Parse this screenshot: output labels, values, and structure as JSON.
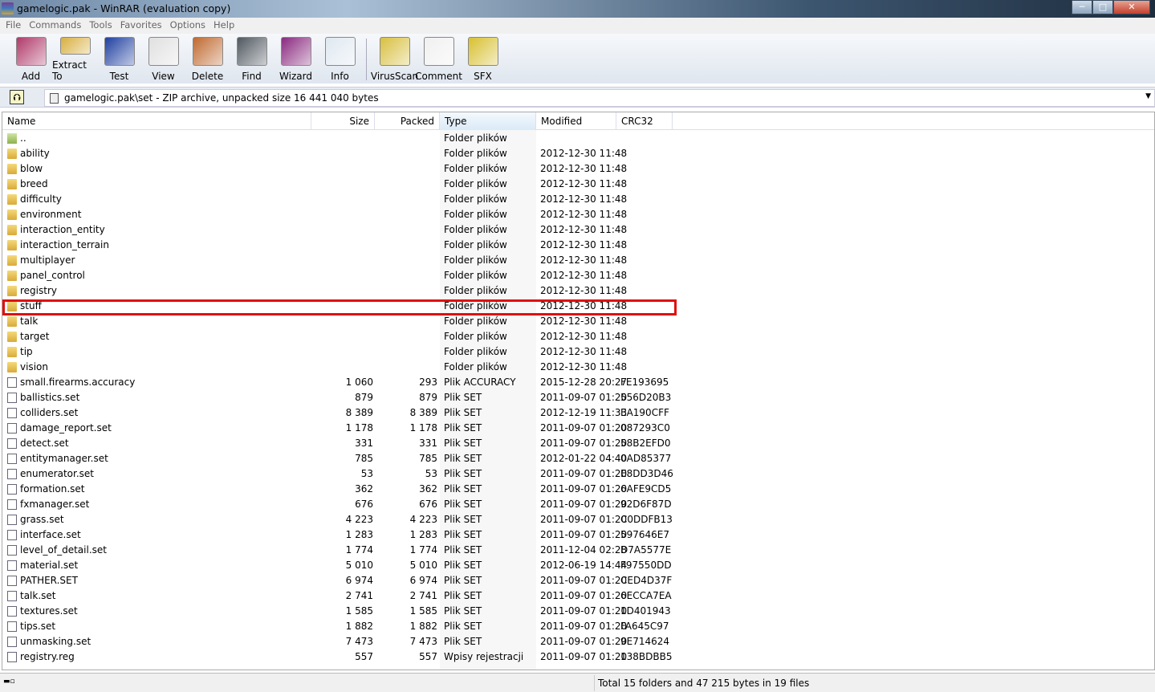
{
  "window": {
    "title": "gamelogic.pak - WinRAR (evaluation copy)",
    "minimize": "─",
    "maximize": "□",
    "close": "✕"
  },
  "menu": [
    "File",
    "Commands",
    "Tools",
    "Favorites",
    "Options",
    "Help"
  ],
  "toolbar": [
    {
      "label": "Add",
      "icon": "add-icon",
      "color": "#b03a6a"
    },
    {
      "label": "Extract To",
      "icon": "extract-icon",
      "color": "#d8b040"
    },
    {
      "label": "Test",
      "icon": "test-icon",
      "color": "#2040a0"
    },
    {
      "label": "View",
      "icon": "view-icon",
      "color": "#e0e0e0"
    },
    {
      "label": "Delete",
      "icon": "delete-icon",
      "color": "#c06a30"
    },
    {
      "label": "Find",
      "icon": "find-icon",
      "color": "#505860"
    },
    {
      "label": "Wizard",
      "icon": "wizard-icon",
      "color": "#8a2a80"
    },
    {
      "label": "Info",
      "icon": "info-icon",
      "color": "#dfe8f0"
    },
    {
      "label": "VirusScan",
      "icon": "virusscan-icon",
      "color": "#d8c040"
    },
    {
      "label": "Comment",
      "icon": "comment-icon",
      "color": "#f0f0f0"
    },
    {
      "label": "SFX",
      "icon": "sfx-icon",
      "color": "#d8c030"
    }
  ],
  "address": {
    "text": "gamelogic.pak\\set - ZIP archive, unpacked size 16 441 040 bytes",
    "dropdown": "▼",
    "up": "⮉"
  },
  "columns": {
    "name": "Name",
    "size": "Size",
    "packed": "Packed",
    "type": "Type",
    "modified": "Modified",
    "crc": "CRC32"
  },
  "rows": [
    {
      "kind": "up",
      "name": "..",
      "size": "",
      "packed": "",
      "type": "Folder plików",
      "modified": "",
      "crc": ""
    },
    {
      "kind": "folder",
      "name": "ability",
      "size": "",
      "packed": "",
      "type": "Folder plików",
      "modified": "2012-12-30 11:48",
      "crc": ""
    },
    {
      "kind": "folder",
      "name": "blow",
      "size": "",
      "packed": "",
      "type": "Folder plików",
      "modified": "2012-12-30 11:48",
      "crc": ""
    },
    {
      "kind": "folder",
      "name": "breed",
      "size": "",
      "packed": "",
      "type": "Folder plików",
      "modified": "2012-12-30 11:48",
      "crc": ""
    },
    {
      "kind": "folder",
      "name": "difficulty",
      "size": "",
      "packed": "",
      "type": "Folder plików",
      "modified": "2012-12-30 11:48",
      "crc": ""
    },
    {
      "kind": "folder",
      "name": "environment",
      "size": "",
      "packed": "",
      "type": "Folder plików",
      "modified": "2012-12-30 11:48",
      "crc": ""
    },
    {
      "kind": "folder",
      "name": "interaction_entity",
      "size": "",
      "packed": "",
      "type": "Folder plików",
      "modified": "2012-12-30 11:48",
      "crc": ""
    },
    {
      "kind": "folder",
      "name": "interaction_terrain",
      "size": "",
      "packed": "",
      "type": "Folder plików",
      "modified": "2012-12-30 11:48",
      "crc": ""
    },
    {
      "kind": "folder",
      "name": "multiplayer",
      "size": "",
      "packed": "",
      "type": "Folder plików",
      "modified": "2012-12-30 11:48",
      "crc": ""
    },
    {
      "kind": "folder",
      "name": "panel_control",
      "size": "",
      "packed": "",
      "type": "Folder plików",
      "modified": "2012-12-30 11:48",
      "crc": ""
    },
    {
      "kind": "folder",
      "name": "registry",
      "size": "",
      "packed": "",
      "type": "Folder plików",
      "modified": "2012-12-30 11:48",
      "crc": ""
    },
    {
      "kind": "folder",
      "name": "stuff",
      "size": "",
      "packed": "",
      "type": "Folder plików",
      "modified": "2012-12-30 11:48",
      "crc": ""
    },
    {
      "kind": "folder",
      "name": "talk",
      "size": "",
      "packed": "",
      "type": "Folder plików",
      "modified": "2012-12-30 11:48",
      "crc": ""
    },
    {
      "kind": "folder",
      "name": "target",
      "size": "",
      "packed": "",
      "type": "Folder plików",
      "modified": "2012-12-30 11:48",
      "crc": ""
    },
    {
      "kind": "folder",
      "name": "tip",
      "size": "",
      "packed": "",
      "type": "Folder plików",
      "modified": "2012-12-30 11:48",
      "crc": ""
    },
    {
      "kind": "folder",
      "name": "vision",
      "size": "",
      "packed": "",
      "type": "Folder plików",
      "modified": "2012-12-30 11:48",
      "crc": ""
    },
    {
      "kind": "file",
      "name": "small.firearms.accuracy",
      "size": "1 060",
      "packed": "293",
      "type": "Plik ACCURACY",
      "modified": "2015-12-28 20:27",
      "crc": "FE193695"
    },
    {
      "kind": "file",
      "name": "ballistics.set",
      "size": "879",
      "packed": "879",
      "type": "Plik SET",
      "modified": "2011-09-07 01:20",
      "crc": "556D20B3"
    },
    {
      "kind": "file",
      "name": "colliders.set",
      "size": "8 389",
      "packed": "8 389",
      "type": "Plik SET",
      "modified": "2012-12-19 11:33",
      "crc": "EA190CFF"
    },
    {
      "kind": "file",
      "name": "damage_report.set",
      "size": "1 178",
      "packed": "1 178",
      "type": "Plik SET",
      "modified": "2011-09-07 01:20",
      "crc": "087293C0"
    },
    {
      "kind": "file",
      "name": "detect.set",
      "size": "331",
      "packed": "331",
      "type": "Plik SET",
      "modified": "2011-09-07 01:20",
      "crc": "58B2EFD0"
    },
    {
      "kind": "file",
      "name": "entitymanager.set",
      "size": "785",
      "packed": "785",
      "type": "Plik SET",
      "modified": "2012-01-22 04:40",
      "crc": "0AD85377"
    },
    {
      "kind": "file",
      "name": "enumerator.set",
      "size": "53",
      "packed": "53",
      "type": "Plik SET",
      "modified": "2011-09-07 01:20",
      "crc": "E8DD3D46"
    },
    {
      "kind": "file",
      "name": "formation.set",
      "size": "362",
      "packed": "362",
      "type": "Plik SET",
      "modified": "2011-09-07 01:20",
      "crc": "6AFE9CD5"
    },
    {
      "kind": "file",
      "name": "fxmanager.set",
      "size": "676",
      "packed": "676",
      "type": "Plik SET",
      "modified": "2011-09-07 01:20",
      "crc": "92D6F87D"
    },
    {
      "kind": "file",
      "name": "grass.set",
      "size": "4 223",
      "packed": "4 223",
      "type": "Plik SET",
      "modified": "2011-09-07 01:20",
      "crc": "C0DDFB13"
    },
    {
      "kind": "file",
      "name": "interface.set",
      "size": "1 283",
      "packed": "1 283",
      "type": "Plik SET",
      "modified": "2011-09-07 01:20",
      "crc": "597646E7"
    },
    {
      "kind": "file",
      "name": "level_of_detail.set",
      "size": "1 774",
      "packed": "1 774",
      "type": "Plik SET",
      "modified": "2011-12-04 02:28",
      "crc": "D7A5577E"
    },
    {
      "kind": "file",
      "name": "material.set",
      "size": "5 010",
      "packed": "5 010",
      "type": "Plik SET",
      "modified": "2012-06-19 14:44",
      "crc": "F97550DD"
    },
    {
      "kind": "file",
      "name": "PATHER.SET",
      "size": "6 974",
      "packed": "6 974",
      "type": "Plik SET",
      "modified": "2011-09-07 01:20",
      "crc": "CED4D37F"
    },
    {
      "kind": "file",
      "name": "talk.set",
      "size": "2 741",
      "packed": "2 741",
      "type": "Plik SET",
      "modified": "2011-09-07 01:20",
      "crc": "6ECCA7EA"
    },
    {
      "kind": "file",
      "name": "textures.set",
      "size": "1 585",
      "packed": "1 585",
      "type": "Plik SET",
      "modified": "2011-09-07 01:20",
      "crc": "1D401943"
    },
    {
      "kind": "file",
      "name": "tips.set",
      "size": "1 882",
      "packed": "1 882",
      "type": "Plik SET",
      "modified": "2011-09-07 01:20",
      "crc": "FA645C97"
    },
    {
      "kind": "file",
      "name": "unmasking.set",
      "size": "7 473",
      "packed": "7 473",
      "type": "Plik SET",
      "modified": "2011-09-07 01:20",
      "crc": "9E714624"
    },
    {
      "kind": "reg",
      "name": "registry.reg",
      "size": "557",
      "packed": "557",
      "type": "Wpisy rejestracji",
      "modified": "2011-09-07 01:20",
      "crc": "138BDBB5"
    }
  ],
  "highlighted_row": "stuff",
  "status": {
    "text": "Total 15 folders and 47 215 bytes in 19 files"
  },
  "colors": {
    "highlight": "#e01010"
  }
}
